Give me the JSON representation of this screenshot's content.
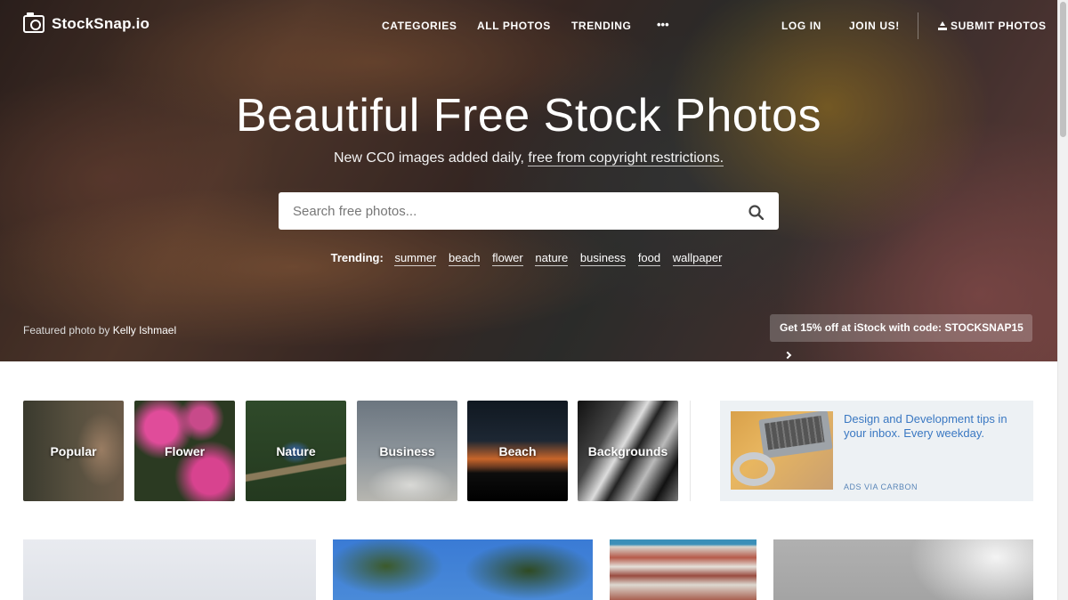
{
  "brand": {
    "name": "StockSnap.io"
  },
  "nav": {
    "categories": "CATEGORIES",
    "all_photos": "ALL PHOTOS",
    "trending": "TRENDING",
    "more": "•••",
    "login": "LOG IN",
    "join": "JOIN US!",
    "submit": "SUBMIT PHOTOS"
  },
  "hero": {
    "title": "Beautiful Free Stock Photos",
    "subtitle_prefix": "New CC0 images added daily, ",
    "subtitle_link": "free from copyright restrictions.",
    "search_placeholder": "Search free photos...",
    "trending_label": "Trending:",
    "trending_tags": [
      "summer",
      "beach",
      "flower",
      "nature",
      "business",
      "food",
      "wallpaper"
    ],
    "featured_prefix": "Featured photo by",
    "featured_author": "Kelly Ishmael",
    "promo": "Get 15% off at iStock with code: STOCKSNAP15"
  },
  "categories": [
    "Popular",
    "Flower",
    "Nature",
    "Business",
    "Beach",
    "Backgrounds"
  ],
  "ad": {
    "text": "Design and Development tips in your inbox. Every weekday.",
    "via": "ADS VIA CARBON"
  },
  "colors": {
    "accent_link": "#3a78c2",
    "ad_bg": "#edf1f4"
  }
}
